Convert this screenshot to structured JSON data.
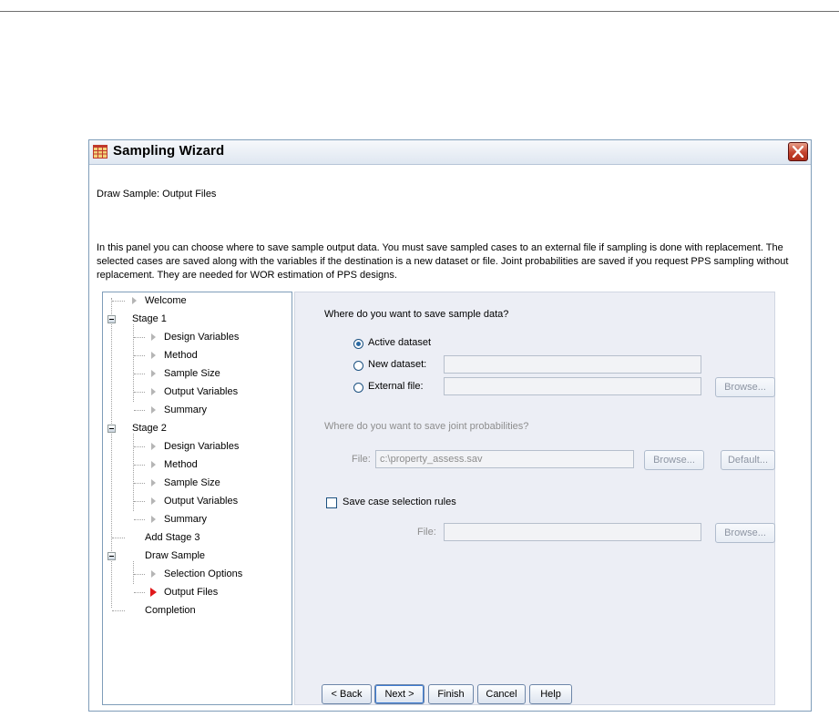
{
  "window": {
    "title": "Sampling Wizard"
  },
  "header": {
    "step_title": "Draw Sample: Output Files",
    "description": "In this panel you can choose where to save sample output data. You must save sampled cases to an external file if sampling is done with replacement. The selected cases are saved along with the variables if the destination is a new dataset or file. Joint probabilities are saved if you request PPS sampling without replacement. They are needed for WOR estimation of PPS designs."
  },
  "tree": {
    "welcome": "Welcome",
    "stage1": "Stage 1",
    "stage1_design": "Design Variables",
    "stage1_method": "Method",
    "stage1_size": "Sample Size",
    "stage1_output": "Output Variables",
    "stage1_summary": "Summary",
    "stage2": "Stage 2",
    "stage2_design": "Design Variables",
    "stage2_method": "Method",
    "stage2_size": "Sample Size",
    "stage2_output": "Output Variables",
    "stage2_summary": "Summary",
    "add_stage3": "Add Stage 3",
    "draw_sample": "Draw Sample",
    "selection_options": "Selection Options",
    "output_files": "Output Files",
    "completion": "Completion"
  },
  "panel": {
    "save_question": "Where do you want to save sample data?",
    "active_dataset": "Active dataset",
    "new_dataset": "New dataset:",
    "new_dataset_value": "",
    "external_file": "External file:",
    "external_file_value": "",
    "browse": "Browse...",
    "joint_question": "Where do you want to save joint probabilities?",
    "file_label": "File:",
    "joint_file_value": "c:\\property_assess.sav",
    "default": "Default...",
    "save_rules": "Save case selection rules",
    "rules_file_value": ""
  },
  "buttons": {
    "back": "< Back",
    "next": "Next >",
    "finish": "Finish",
    "cancel": "Cancel",
    "help": "Help"
  }
}
